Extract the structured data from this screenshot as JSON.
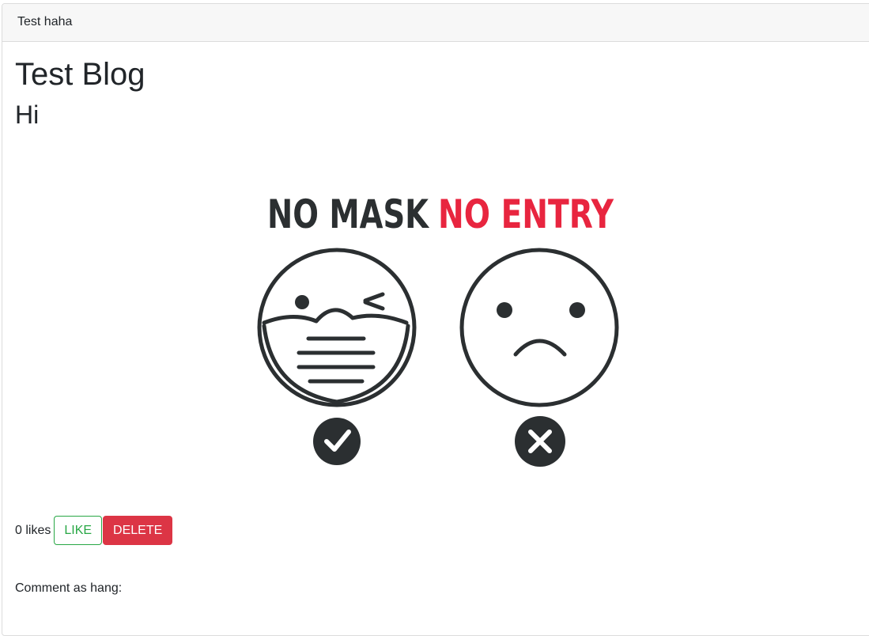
{
  "header": {
    "title": "Test haha"
  },
  "post": {
    "title": "Test Blog",
    "body": "Hi",
    "image": {
      "headline_left": "NO MASK",
      "headline_right": "NO ENTRY",
      "left_face": "masked-winking-face-icon",
      "right_face": "sad-face-icon",
      "left_status": "checkmark-icon",
      "right_status": "cross-icon",
      "colors": {
        "dark": "#2b2f31",
        "red": "#e8253f"
      }
    }
  },
  "actions": {
    "likes_text": "0 likes",
    "like_label": "LIKE",
    "delete_label": "DELETE"
  },
  "comment": {
    "label": "Comment as hang:"
  },
  "colors": {
    "like_green": "#28a745",
    "delete_red": "#dc3545",
    "header_bg": "#f7f7f7"
  }
}
